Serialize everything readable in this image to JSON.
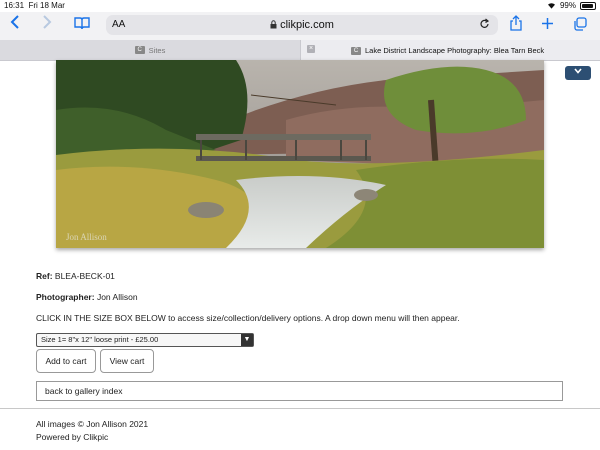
{
  "status_bar": {
    "time": "16:31",
    "date": "Fri 18 Mar",
    "battery": "99%"
  },
  "browser": {
    "text_size_label": "AA",
    "url": "clikpic.com",
    "tabs": [
      {
        "favicon": "C",
        "label": "Sites",
        "active": false
      },
      {
        "favicon": "C",
        "label": "Lake District Landscape Photography: Blea Tarn Beck",
        "active": true
      }
    ],
    "icons": [
      "chevron-left-icon",
      "chevron-right-icon",
      "book-icon",
      "lock-icon",
      "reload-icon",
      "share-icon",
      "plus-icon",
      "tabs-icon",
      "wifi-icon"
    ]
  },
  "page": {
    "ref_label": "Ref:",
    "ref_value": "BLEA-BECK-01",
    "photographer_label": "Photographer:",
    "photographer_value": "Jon Allison",
    "instructions": "CLICK IN THE SIZE BOX BELOW to access size/collection/delivery options. A drop down menu will then appear.",
    "size_selected": "Size 1= 8\"x 12\" loose print - £25.00",
    "add_to_cart": "Add to cart",
    "view_cart": "View cart",
    "back_link": "back to gallery index",
    "copyright": "All images © Jon Allison 2021",
    "powered_by": "Powered by Clikpic"
  }
}
